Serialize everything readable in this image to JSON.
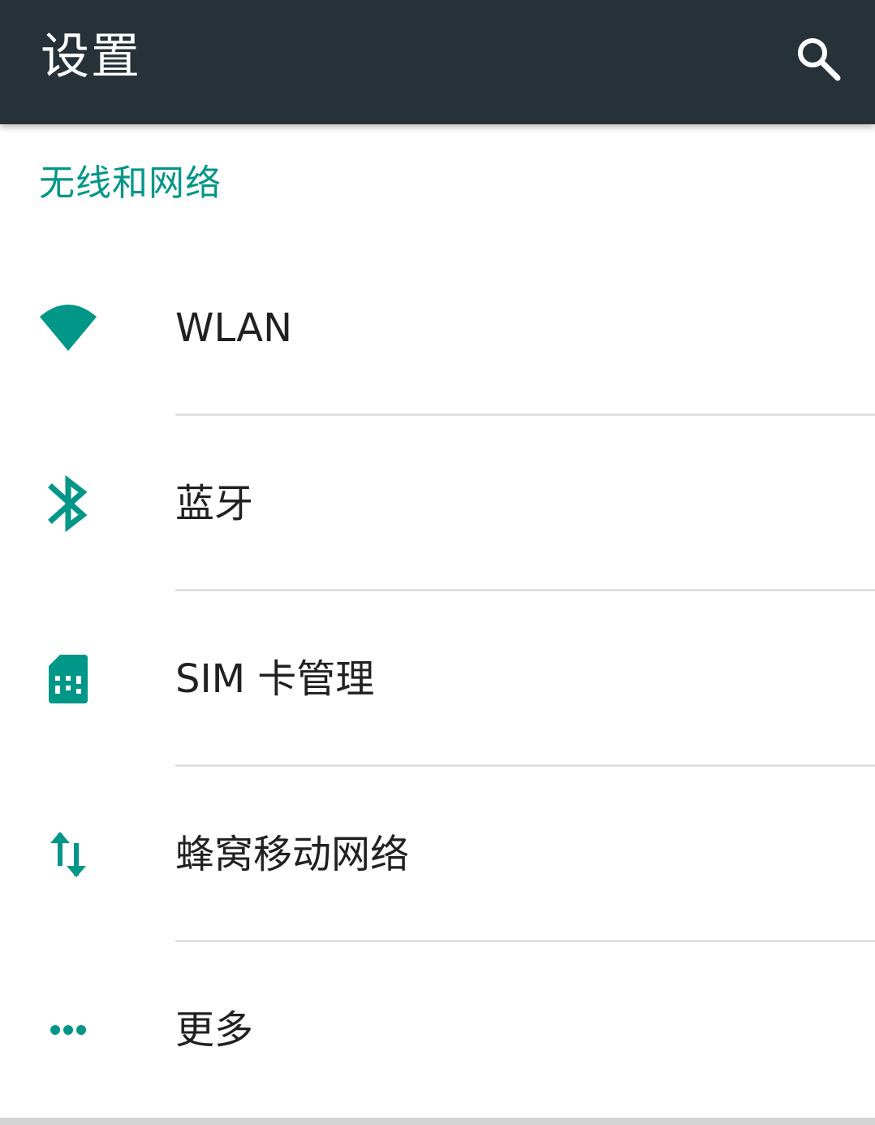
{
  "app_bar": {
    "title": "设置",
    "search_icon": "search-icon",
    "background": "#263238"
  },
  "section": {
    "title": "无线和网络",
    "accent_color": "#009688"
  },
  "items": [
    {
      "label": "WLAN",
      "icon": "wifi-icon"
    },
    {
      "label": "蓝牙",
      "icon": "bluetooth-icon"
    },
    {
      "label": "SIM 卡管理",
      "icon": "sim-card-icon"
    },
    {
      "label": "蜂窝移动网络",
      "icon": "data-arrows-icon"
    },
    {
      "label": "更多",
      "icon": "more-dots-icon"
    }
  ]
}
